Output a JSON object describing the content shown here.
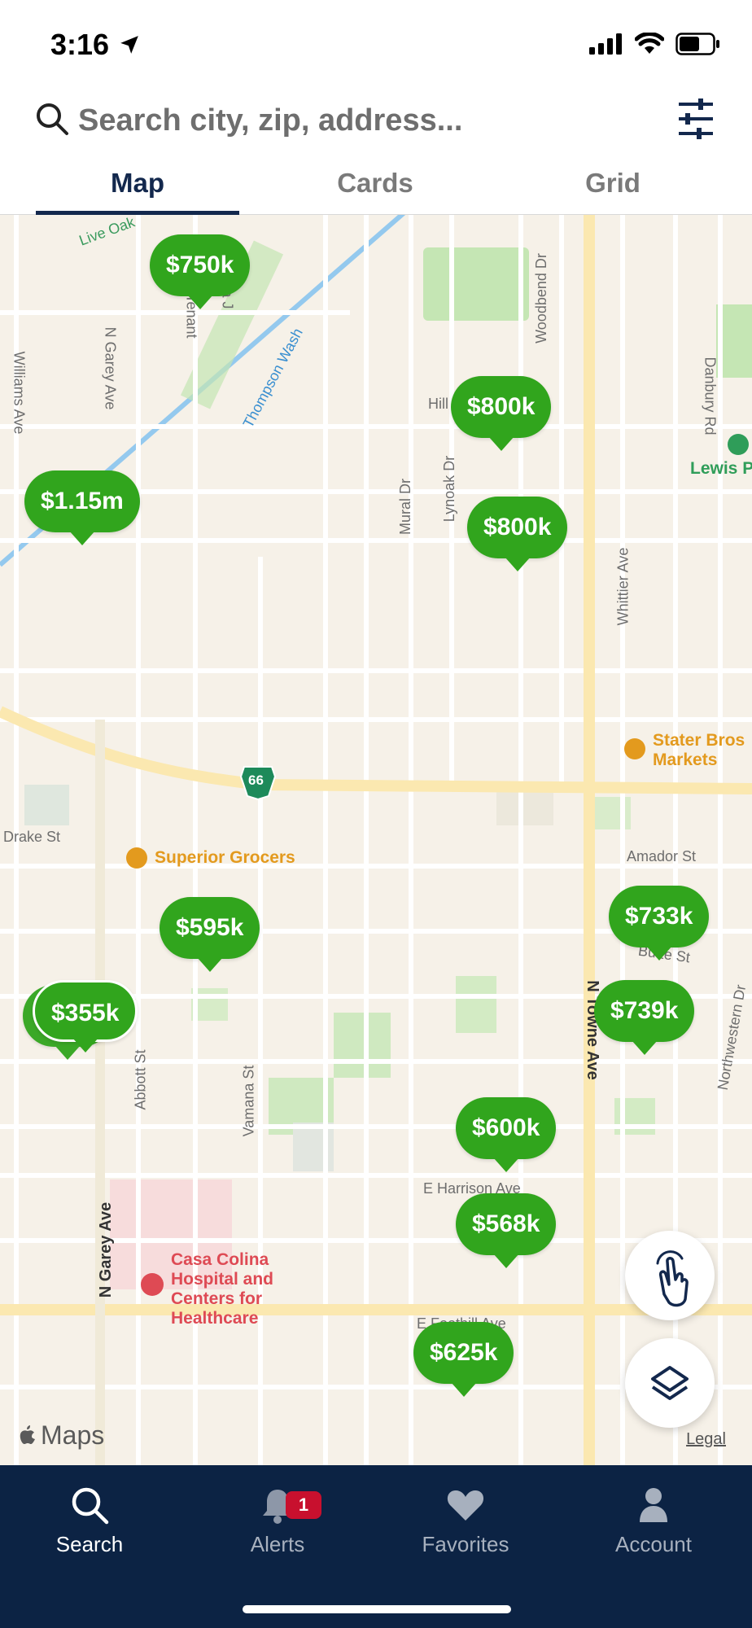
{
  "status_bar": {
    "time": "3:16"
  },
  "search": {
    "placeholder": "Search city, zip, address..."
  },
  "tabs": [
    {
      "label": "Map",
      "active": true
    },
    {
      "label": "Cards",
      "active": false
    },
    {
      "label": "Grid",
      "active": false
    }
  ],
  "map": {
    "pins": [
      "$750k",
      "$800k",
      "$800k",
      "$1.15m",
      "$595k",
      "$355k",
      "$733k",
      "$739k",
      "$600k",
      "$568k",
      "$625k"
    ],
    "streets": [
      "Live Oak",
      "Williams Ave",
      "N Garey Ave",
      "Tenant",
      "La J",
      "Thompson Wash",
      "Hill",
      "Woodbend Dr",
      "Danbury Rd",
      "Mural Dr",
      "Lynoak Dr",
      "Whittier Ave",
      "Drake St",
      "Amador St",
      "Butte St",
      "N Towne Ave",
      "Northwestern Dr",
      "Abbott St",
      "Vamana St",
      "E Harrison Ave",
      "N Garey Ave",
      "E Foothill Ave"
    ],
    "route_shield": "66",
    "pois": {
      "lewis_park": "Lewis P",
      "stater_bros": [
        "Stater Bros",
        "Markets"
      ],
      "superior_grocers": "Superior Grocers",
      "casa_colina": [
        "Casa Colina",
        "Hospital and",
        "Centers for",
        "Healthcare"
      ]
    },
    "attribution": "Maps",
    "legal": "Legal"
  },
  "nav": {
    "items": [
      {
        "label": "Search",
        "icon": "search-icon",
        "active": true
      },
      {
        "label": "Alerts",
        "icon": "bell-icon",
        "active": false,
        "badge": "1"
      },
      {
        "label": "Favorites",
        "icon": "heart-icon",
        "active": false
      },
      {
        "label": "Account",
        "icon": "person-icon",
        "active": false
      }
    ]
  },
  "colors": {
    "brand_navy": "#0c2344",
    "pin_green": "#31a51d",
    "map_bg": "#f6f1e8"
  }
}
